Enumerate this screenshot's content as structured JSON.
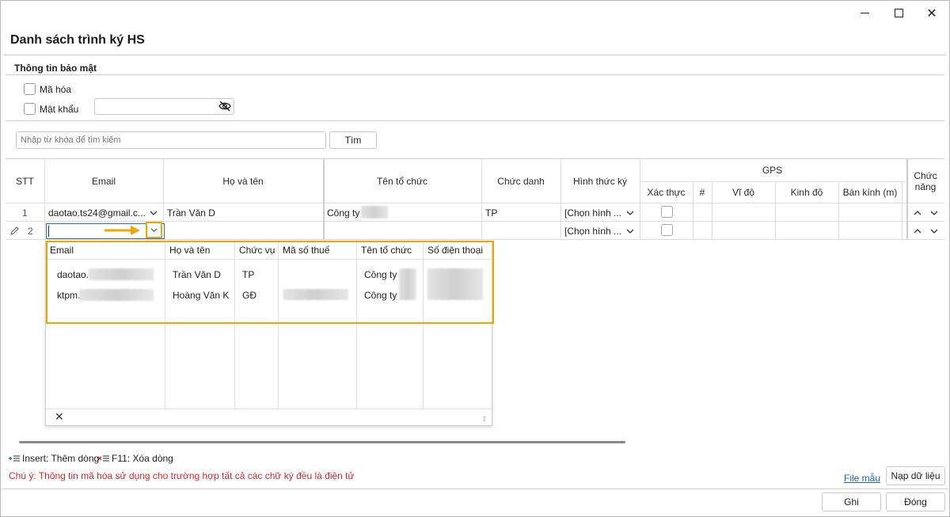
{
  "window": {
    "title": "Danh sách trình ký HS",
    "controls": [
      "minimize",
      "maximize",
      "close"
    ]
  },
  "security": {
    "section_title": "Thông tin bảo mật",
    "encrypt_label": "Mã hóa",
    "password_label": "Mật khẩu",
    "password_value": "",
    "encrypt_checked": false,
    "password_checked": false
  },
  "search": {
    "placeholder": "Nhập từ khóa để tìm kiếm",
    "button_label": "Tìm"
  },
  "grid": {
    "headers": {
      "stt": "STT",
      "email": "Email",
      "name": "Họ và tên",
      "org": "Tên tổ chức",
      "title": "Chức danh",
      "sign_type": "Hình thức ký",
      "gps": "GPS",
      "verify": "Xác thực",
      "hash": "#",
      "lat": "Vĩ độ",
      "lng": "Kinh độ",
      "radius": "Bán kính (m)",
      "function": "Chức năng"
    },
    "rows": [
      {
        "stt": "1",
        "email": "daotao.ts24@gmail.c...",
        "name": "Trần Văn D",
        "org": "Công ty",
        "title": "TP",
        "sign_type": "[Chọn hình ..."
      },
      {
        "stt": "2",
        "email": "",
        "name": "",
        "org": "",
        "title": "",
        "sign_type": "[Chọn hình ..."
      }
    ]
  },
  "popup": {
    "headers": {
      "email": "Email",
      "name": "Họ và tên",
      "position": "Chức vụ",
      "tax": "Mã số thuế",
      "org": "Tên tổ chức",
      "phone": "Số điện thoại"
    },
    "rows": [
      {
        "email": "daotao.",
        "name": "Trần Văn D",
        "position": "TP",
        "org": "Công ty"
      },
      {
        "email": "ktpm.",
        "name": "Hoàng Văn K",
        "position": "GĐ",
        "org": "Công ty"
      }
    ]
  },
  "footer": {
    "insert_hint": "Insert: Thêm dòng",
    "delete_hint": "F11: Xóa dòng",
    "note": "Chú ý: Thông tin mã hóa sử dụng cho trường hợp tất cả các chữ ký đều là điện tử",
    "sample_link": "File mẫu",
    "load_button": "Nạp dữ liệu",
    "save_button": "Ghi",
    "close_button": "Đóng"
  },
  "colors": {
    "highlight": "#f0a500",
    "note_red": "#d9262a",
    "link_blue": "#1e5fb3",
    "focus_blue": "#2b6fc6"
  }
}
